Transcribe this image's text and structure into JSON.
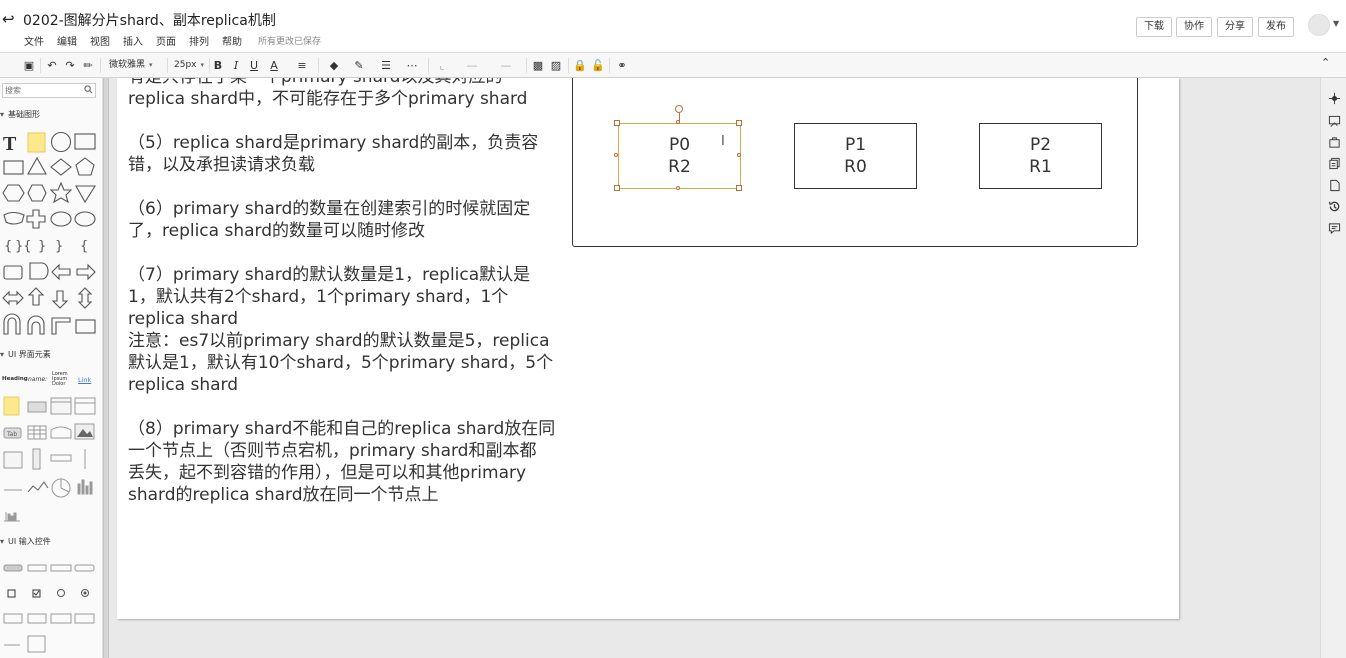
{
  "title_bar": {
    "back_icon": "back-arrow-icon",
    "doc_title": "0202-图解分片shard、副本replica机制",
    "menu": [
      "文件",
      "编辑",
      "视图",
      "插入",
      "页面",
      "排列",
      "帮助"
    ],
    "save_status": "所有更改已保存",
    "buttons": {
      "download": "下载",
      "collaborate": "协作",
      "share": "分享",
      "publish": "发布"
    }
  },
  "toolbar": {
    "font_family": "微软雅黑",
    "font_size": "25px",
    "bold": "B",
    "italic": "I",
    "underline": "U",
    "font_color": "A",
    "caret": "▾"
  },
  "left_panel": {
    "search_placeholder": "搜索",
    "sections": {
      "basic": "基础图形",
      "ui_elements": "UI 界面元素",
      "ui_inputs": "UI 输入控件"
    },
    "ui_element_labels": {
      "heading": "Heading",
      "name": "name:",
      "lorem": "Lorem Ipsum Dolor",
      "link": "Link",
      "tab": "Tab"
    }
  },
  "document": {
    "lines": [
      "有是只存在于某一个primary shard以及其对应的",
      "replica shard中，不可能存在于多个primary shard",
      "",
      "（5）replica shard是primary shard的副本，负责容",
      "错，以及承担读请求负载",
      "",
      "（6）primary shard的数量在创建索引的时候就固定",
      "了，replica shard的数量可以随时修改",
      "",
      "（7）primary shard的默认数量是1，replica默认是",
      "1，默认共有2个shard，1个primary shard，1个",
      "replica shard",
      "注意：es7以前primary shard的默认数量是5，replica",
      "默认是1，默认有10个shard，5个primary shard，5个",
      "replica shard",
      "",
      "（8）primary shard不能和自己的replica shard放在同",
      "一个节点上（否则节点宕机，primary shard和副本都",
      "丢失，起不到容错的作用），但是可以和其他primary",
      "shard的replica shard放在同一个节点上"
    ]
  },
  "diagram": {
    "nodes": [
      {
        "primary": "P0",
        "replica": "R2"
      },
      {
        "primary": "P1",
        "replica": "R0"
      },
      {
        "primary": "P2",
        "replica": "R1"
      }
    ],
    "selection_color": "#d6a84b"
  },
  "right_panel": {
    "icons": [
      "navigate-icon",
      "style-icon",
      "page-setup-icon",
      "layers-icon",
      "page-icon",
      "history-icon",
      "comments-icon"
    ],
    "collapse_icon": "collapse-up-icon"
  }
}
